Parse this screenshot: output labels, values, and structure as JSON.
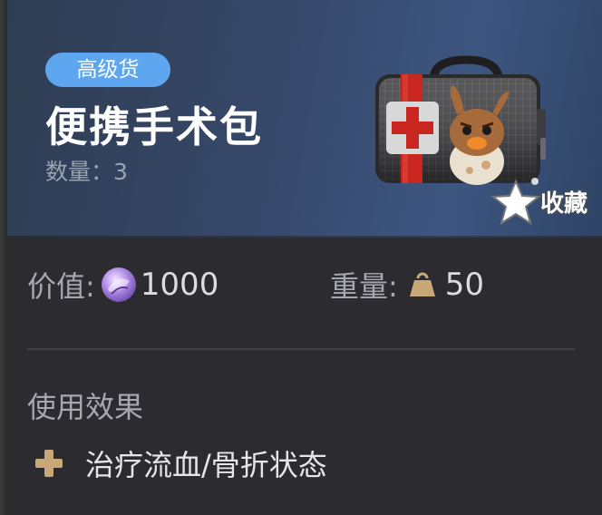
{
  "item": {
    "grade": "高级货",
    "name": "便携手术包",
    "quantity_label": "数量：",
    "quantity_value": "3",
    "icon": "medical-kit-with-bird-icon"
  },
  "favorite": {
    "label": "收藏",
    "icon": "star-icon"
  },
  "stats": {
    "value_label": "价值:",
    "value_icon": "crystal-coin-icon",
    "value": "1000",
    "weight_label": "重量:",
    "weight_icon": "weight-icon",
    "weight": "50"
  },
  "effect": {
    "title": "使用效果",
    "icon": "plus-icon",
    "text": "治疗流血/骨折状态"
  },
  "colors": {
    "grade_badge": "#5ea6f0",
    "header_bg": "#36486a",
    "panel_bg": "#2c2b30",
    "accent_gold": "#c9a877"
  }
}
